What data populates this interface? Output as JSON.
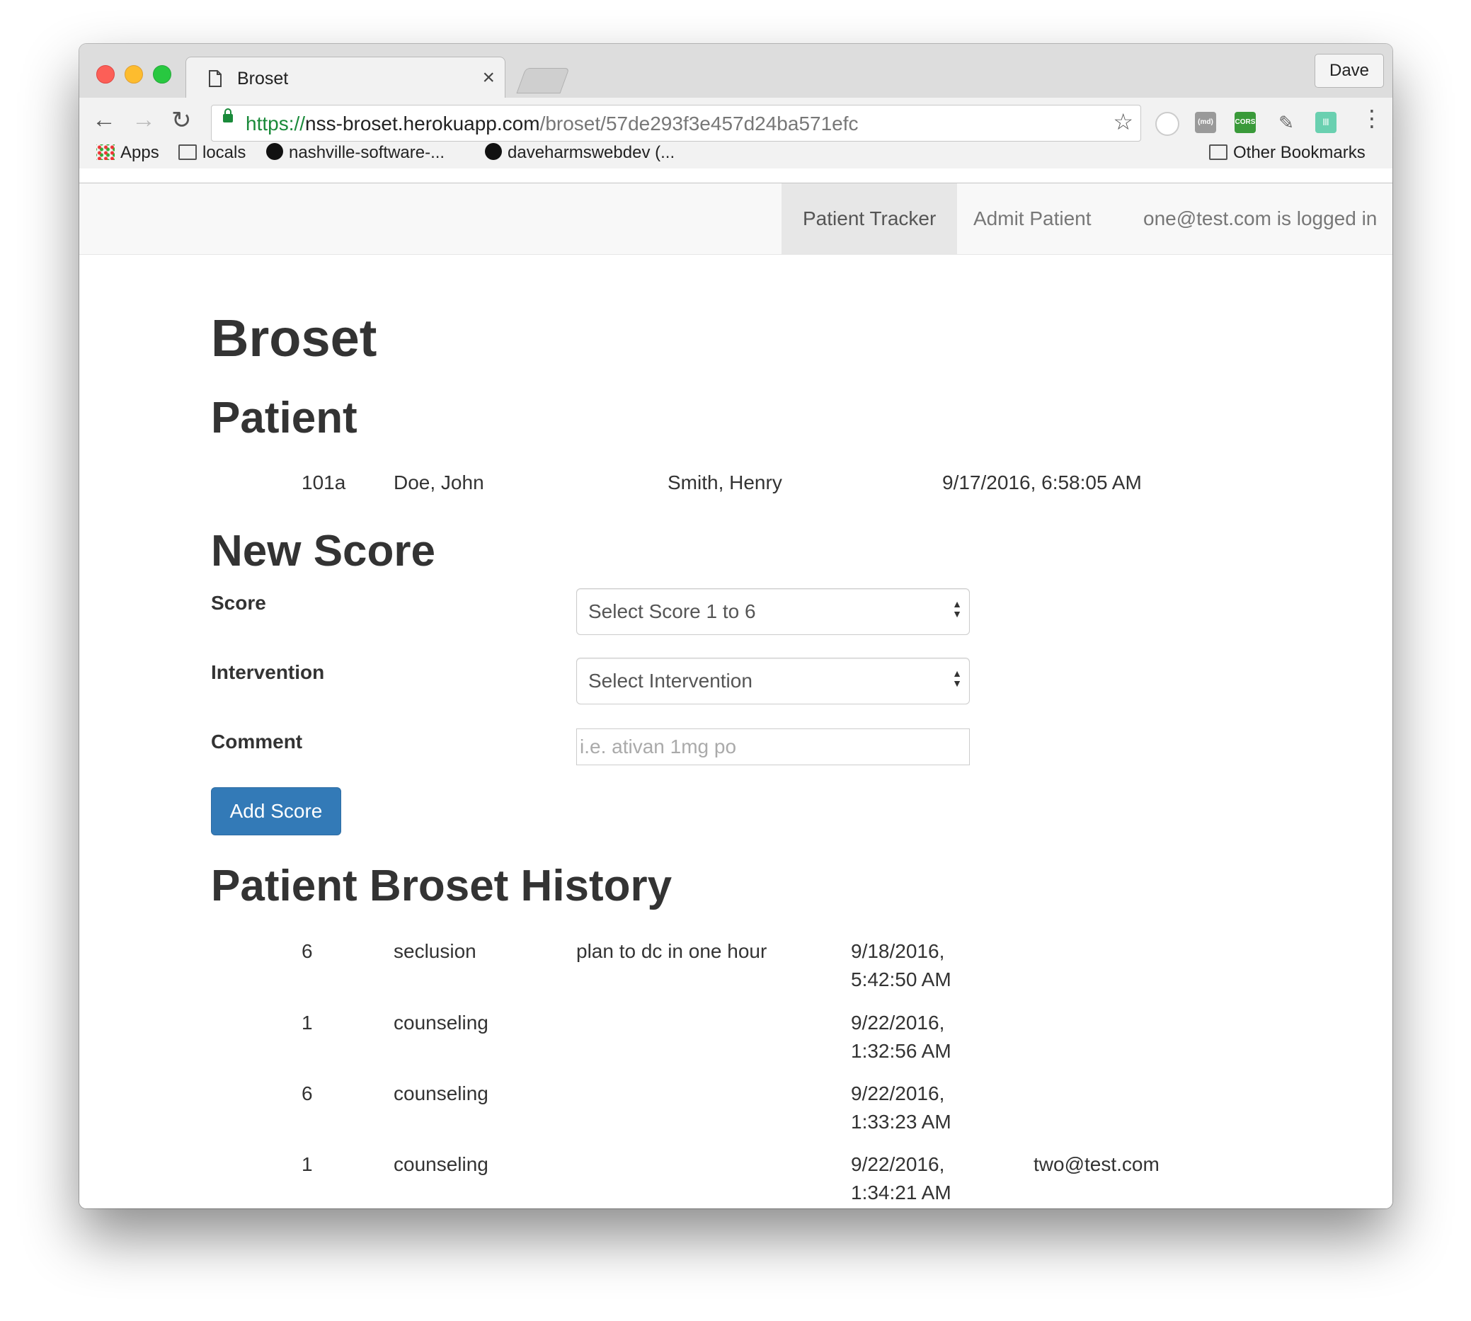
{
  "browser": {
    "tab_title": "Broset",
    "tab_close": "×",
    "profile_name": "Dave",
    "url_scheme": "https://",
    "url_host": "nss-broset.herokuapp.com",
    "url_path": "/broset/57de293f3e457d24ba571efc",
    "ext_md": "(md)",
    "ext_cors": "CORS",
    "bookmarks": [
      {
        "label": "Apps",
        "icon": "apps-icon"
      },
      {
        "label": "locals",
        "icon": "folder-icon"
      },
      {
        "label": "nashville-software-...",
        "icon": "github-icon"
      },
      {
        "label": "daveharmswebdev (...",
        "icon": "github-icon"
      }
    ],
    "other_bookmarks": "Other Bookmarks"
  },
  "navbar": {
    "links": [
      "Patient Tracker",
      "Admit Patient"
    ],
    "user_status": "one@test.com is logged in"
  },
  "page": {
    "title": "Broset",
    "patient_heading": "Patient",
    "patient": {
      "room": "101a",
      "name": "Doe, John",
      "provider": "Smith, Henry",
      "admitted": "9/17/2016, 6:58:05 AM"
    },
    "new_score_heading": "New Score",
    "form": {
      "score_label": "Score",
      "score_select": "Select Score 1 to 6",
      "intervention_label": "Intervention",
      "intervention_select": "Select Intervention",
      "comment_label": "Comment",
      "comment_placeholder": "i.e. ativan 1mg po",
      "submit_label": "Add Score"
    },
    "history_heading": "Patient Broset History",
    "history": [
      {
        "score": "6",
        "intervention": "seclusion",
        "comment": "plan to dc in one hour",
        "date": "9/18/2016,",
        "time": "5:42:50 AM",
        "user": ""
      },
      {
        "score": "1",
        "intervention": "counseling",
        "comment": "",
        "date": "9/22/2016,",
        "time": "1:32:56 AM",
        "user": ""
      },
      {
        "score": "6",
        "intervention": "counseling",
        "comment": "",
        "date": "9/22/2016,",
        "time": "1:33:23 AM",
        "user": ""
      },
      {
        "score": "1",
        "intervention": "counseling",
        "comment": "",
        "date": "9/22/2016,",
        "time": "1:34:21 AM",
        "user": "two@test.com"
      }
    ]
  }
}
